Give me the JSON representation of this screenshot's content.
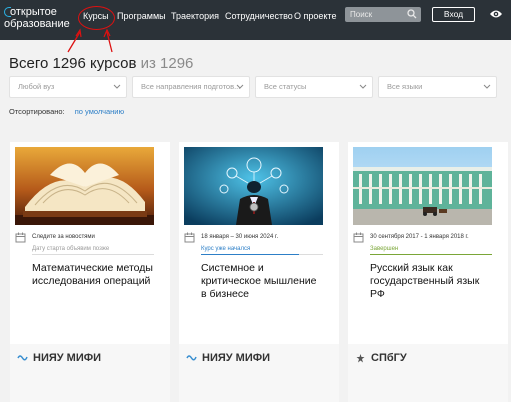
{
  "header": {
    "logo_line1": "открытое",
    "logo_line2": "образование",
    "nav": [
      "Курсы",
      "Программы",
      "Траектория",
      "Сотрудничество",
      "О проекте"
    ],
    "search_placeholder": "Поиск",
    "login_label": "Вход"
  },
  "heading": {
    "total": "Всего 1296 курсов",
    "of": "из 1296"
  },
  "filters": [
    "Любой вуз",
    "Все направления подготов...",
    "Все статусы",
    "Все языки"
  ],
  "sort": {
    "label": "Отсортировано:",
    "value": "по умолчанию"
  },
  "cards": [
    {
      "date": "Следите за новостями",
      "status": "Дату старта объявим позже",
      "status_color": "#9a9a9a",
      "progress": 0,
      "title": "Математические методы исследования операций",
      "university": "НИЯУ МИФИ"
    },
    {
      "date": "18 января – 30 июня 2024 г.",
      "status": "Курс уже начался",
      "status_color": "#2d7fc7",
      "progress": 0.8,
      "title": "Системное и критическое мышление в бизнесе",
      "university": "НИЯУ МИФИ"
    },
    {
      "date": "30 сентября 2017 - 1 января 2018 г.",
      "status": "Завершен",
      "status_color": "#7aa637",
      "progress": 1,
      "title": "Русский язык как государственный язык РФ",
      "university": "СПбГУ"
    }
  ],
  "colors": {
    "header_bg": "#2b3238",
    "accent_blue": "#2d7fc7",
    "annotation_red": "#d11111"
  }
}
